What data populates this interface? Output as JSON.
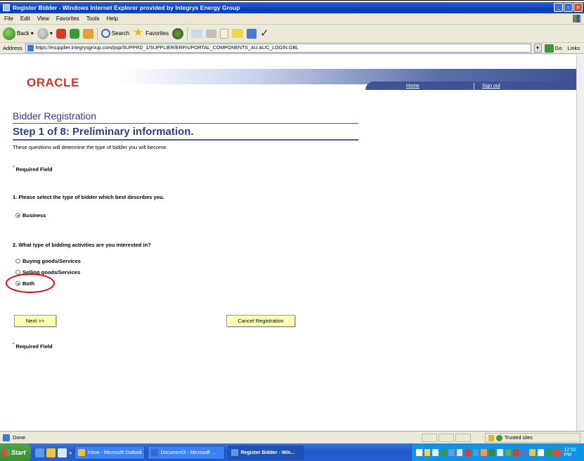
{
  "window": {
    "title": "Register Bidder - Windows Internet Explorer provided by Integrys Energy Group"
  },
  "menu": [
    "File",
    "Edit",
    "View",
    "Favorites",
    "Tools",
    "Help"
  ],
  "toolbar": {
    "back_label": "Back",
    "search_label": "Search",
    "favorites_label": "Favorites"
  },
  "address": {
    "label": "Address",
    "url": "https://esupplier.integrysgroup.com/psp/SUPPRD_1/SUPPLIER/ERP/s/PORTAL_COMPONENTS_AU.AUC_LOGIN.GBL",
    "go_label": "Go",
    "links_label": "Links"
  },
  "header": {
    "logo": "ORACLE",
    "home_link": "Home",
    "signout_link": "Sign out"
  },
  "page": {
    "title": "Bidder Registration",
    "step": "Step 1 of 8: Preliminary information.",
    "intro": "These questions will determine the type of bidder you will become.",
    "required_note": "Required Field",
    "q1": "1. Please select the type of bidder which best describes you.",
    "q1_options": [
      {
        "label": "Business",
        "selected": true
      }
    ],
    "q2": "2. What type of bidding activities are you interested in?",
    "q2_options": [
      {
        "label": "Buying goods/Services",
        "selected": false
      },
      {
        "label": "Selling goods/Services",
        "selected": false
      },
      {
        "label": "Both",
        "selected": true
      }
    ],
    "next_button": "Next >>",
    "cancel_button": "Cancel Registration"
  },
  "status": {
    "text": "Done",
    "zone": "Trusted sites"
  },
  "taskbar": {
    "start": "Start",
    "more": "»",
    "tasks": [
      {
        "label": "Inbox - Microsoft Outlook",
        "active": false
      },
      {
        "label": "Document3 - Microsoft ...",
        "active": false
      },
      {
        "label": "Register Bidder - Win...",
        "active": true
      }
    ],
    "clock": "12:52 PM"
  },
  "colors": {
    "heading": "#2e3f8c",
    "oracle_red": "#e0302a",
    "button_bg": "#ffffb0",
    "highlight": "#e00000"
  }
}
